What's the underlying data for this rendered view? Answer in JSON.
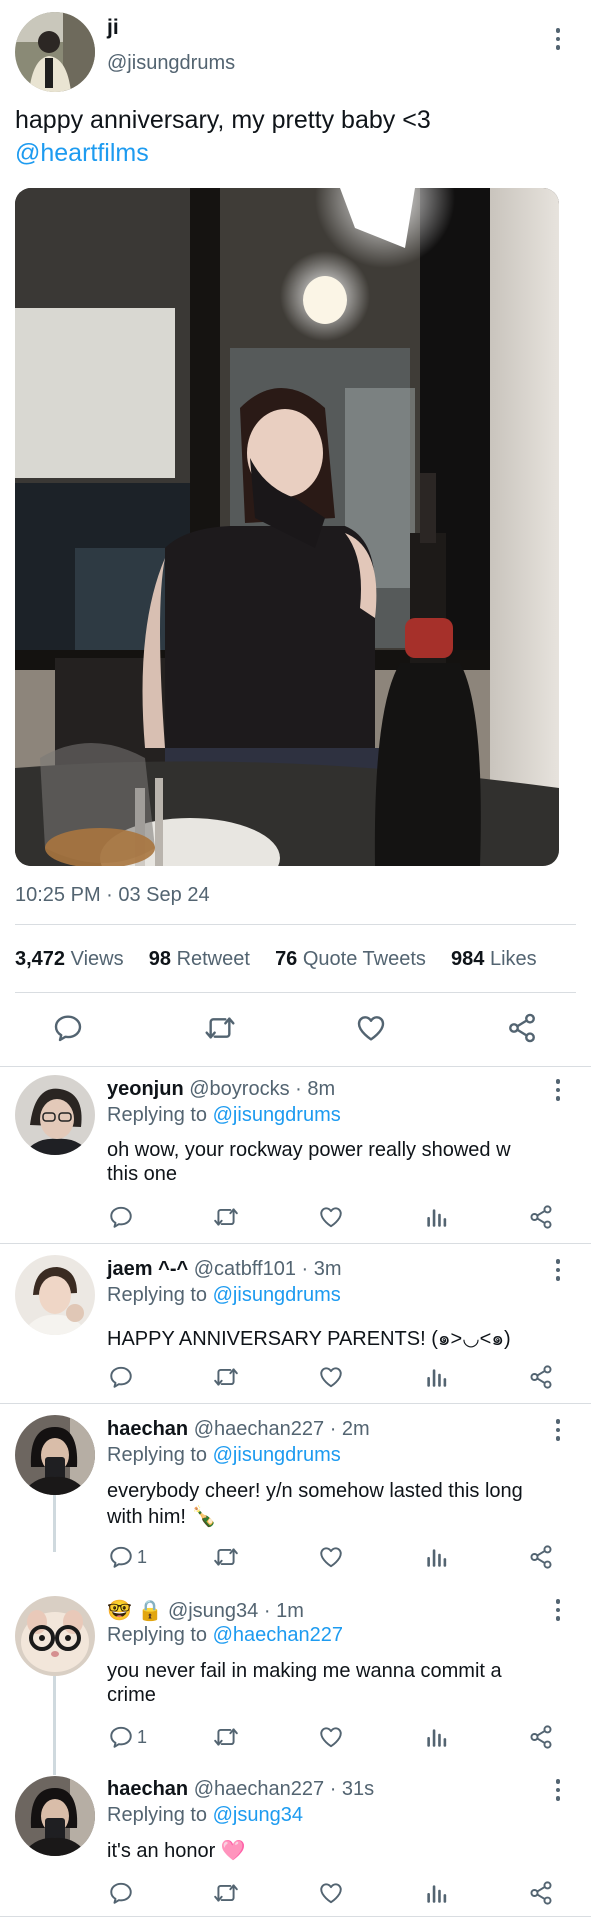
{
  "tweet": {
    "name": "ji",
    "handle": "@jisungdrums",
    "text": "happy anniversary, my pretty baby <3",
    "mention": "@heartfilms",
    "timestamp": "10:25 PM · 03 Sep 24",
    "stats": {
      "views_count": "3,472",
      "views_label": "Views",
      "retweets_count": "98",
      "retweets_label": "Retweet",
      "quotes_count": "76",
      "quotes_label": "Quote Tweets",
      "likes_count": "984",
      "likes_label": "Likes"
    }
  },
  "replies": [
    {
      "name": "yeonjun",
      "handle": "@boyrocks",
      "time": "· 8m",
      "replying_label": "Replying to",
      "replying_to": "@jisungdrums",
      "text_line1": "oh wow, your rockway power really showed w",
      "text_line2": "this one",
      "reply_count": ""
    },
    {
      "name": "jaem ^-^",
      "handle": "@catbff101",
      "time": "· 3m",
      "replying_label": "Replying to",
      "replying_to": "@jisungdrums",
      "text_line1": "HAPPY ANNIVERSARY PARENTS! (๑>◡<๑)",
      "reply_count": ""
    },
    {
      "name": "haechan",
      "handle": "@haechan227",
      "time": "· 2m",
      "replying_label": "Replying to",
      "replying_to": "@jisungdrums",
      "text_line1": "everybody cheer! y/n somehow lasted this long",
      "text_line2": "with him! 🍾",
      "reply_count": "1"
    },
    {
      "name": "🤓 🔒",
      "handle": "@jsung34",
      "time": "· 1m",
      "replying_label": "Replying to",
      "replying_to": "@haechan227",
      "text_line1": "you never fail in making me wanna commit a",
      "text_line2": "crime",
      "reply_count": "1"
    },
    {
      "name": "haechan",
      "handle": "@haechan227",
      "time": "· 31s",
      "replying_label": "Replying to",
      "replying_to": "@jsung34",
      "text_line1": "it's an honor 🩷",
      "reply_count": ""
    }
  ],
  "icons": {
    "reply": "reply-icon",
    "retweet": "retweet-icon",
    "like": "heart-icon",
    "views": "views-icon",
    "share": "share-icon",
    "more": "more-icon"
  },
  "colors": {
    "link": "#1d9bf0",
    "muted": "#536471",
    "text": "#0f1419",
    "divider": "#d9dde1"
  }
}
